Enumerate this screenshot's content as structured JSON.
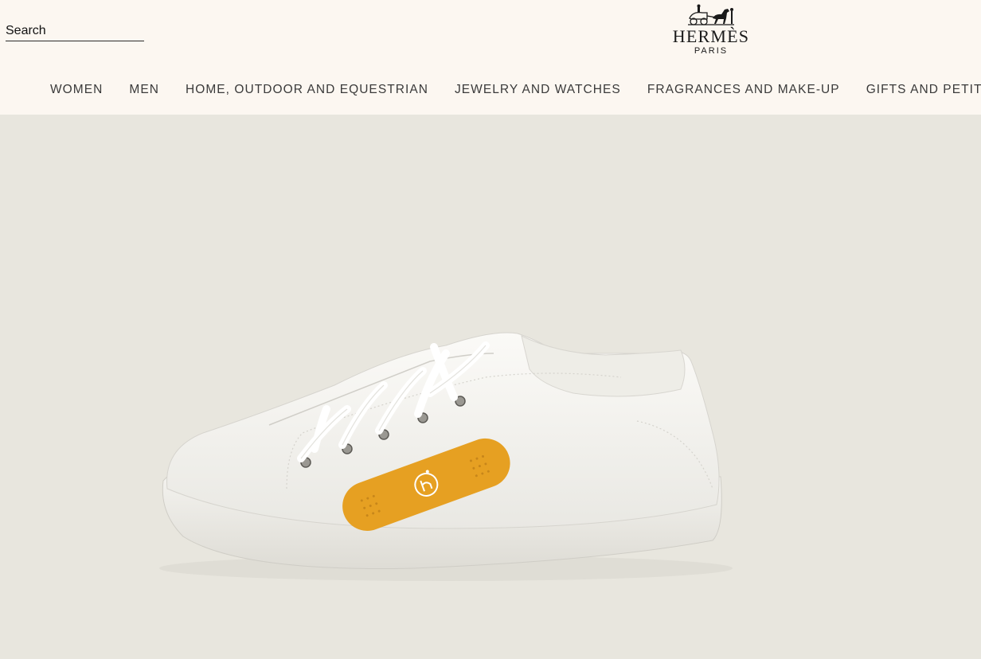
{
  "search": {
    "placeholder": "Search"
  },
  "brand": {
    "name": "HERMÈS",
    "subtitle": "PARIS"
  },
  "nav": {
    "items": [
      {
        "label": "WOMEN"
      },
      {
        "label": "MEN"
      },
      {
        "label": "HOME, OUTDOOR AND EQUESTRIAN"
      },
      {
        "label": "JEWELRY AND WATCHES"
      },
      {
        "label": "FRAGRANCES AND MAKE-UP"
      },
      {
        "label": "GIFTS AND PETIT H"
      }
    ]
  },
  "hero": {
    "image": "white leather sneaker with orange bandage patch",
    "colors": {
      "background": "#e8e6de",
      "shoe": "#f4f3ef",
      "patch": "#e6a022"
    }
  },
  "colors": {
    "header_bg": "#fcf7f1",
    "text": "#3a3a3a"
  }
}
